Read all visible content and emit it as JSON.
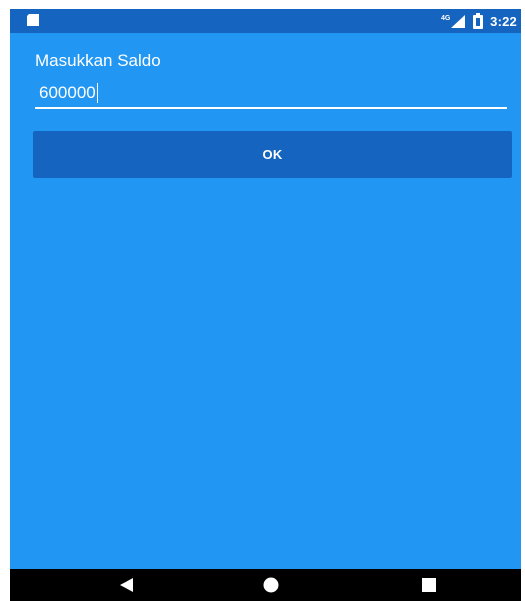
{
  "status_bar": {
    "time": "3:22",
    "icons": [
      "sd-card-icon",
      "signal-4g-icon",
      "battery-icon"
    ],
    "background": "#1565c0"
  },
  "form": {
    "label": "Masukkan Saldo",
    "amount_value": "600000",
    "ok_label": "OK"
  },
  "navigation": {
    "buttons": [
      "back-icon",
      "home-icon",
      "recents-icon"
    ]
  },
  "colors": {
    "screen_background": "#2196f3",
    "primary_dark": "#1565c0",
    "text": "#ffffff",
    "nav_bar": "#000000"
  }
}
